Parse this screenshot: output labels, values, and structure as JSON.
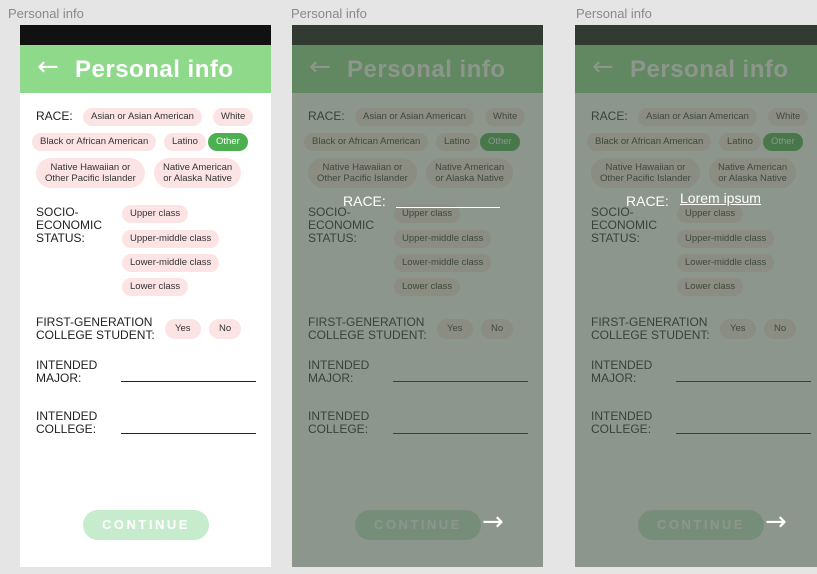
{
  "frames": [
    {
      "label": "Personal info"
    },
    {
      "label": "Personal info"
    },
    {
      "label": "Personal info"
    }
  ],
  "screen": {
    "title": "Personal info",
    "back_icon": "←",
    "race": {
      "label": "RACE:",
      "options": [
        "Asian or Asian American",
        "White",
        "Black or African American",
        "Latino",
        "Other"
      ],
      "nh_line1": "Native Hawaiian or",
      "nh_line2": "Other Pacific Islander",
      "na_line1": "Native American",
      "na_line2": "or Alaska Native",
      "selected": "Other"
    },
    "socio": {
      "label1": "SOCIO-",
      "label2": "ECONOMIC",
      "label3": "STATUS:",
      "options": [
        "Upper class",
        "Upper-middle class",
        "Lower-middle class",
        "Lower class"
      ]
    },
    "firstgen": {
      "label1": "FIRST-GENERATION",
      "label2": "COLLEGE STUDENT:",
      "yes": "Yes",
      "no": "No"
    },
    "major": {
      "label1": "INTENDED",
      "label2": "MAJOR:"
    },
    "college": {
      "label1": "INTENDED",
      "label2": "COLLEGE:"
    },
    "continue": "CONTINUE",
    "next_icon": "→"
  },
  "overlay2": {
    "label": "RACE:"
  },
  "overlay3": {
    "label": "RACE:",
    "value": "Lorem ipsum"
  },
  "colors": {
    "header": "#8fd98b",
    "pill": "#fce4e4",
    "selected": "#4caf50",
    "continue": "#c6ebcd",
    "overlay": "#465546"
  }
}
